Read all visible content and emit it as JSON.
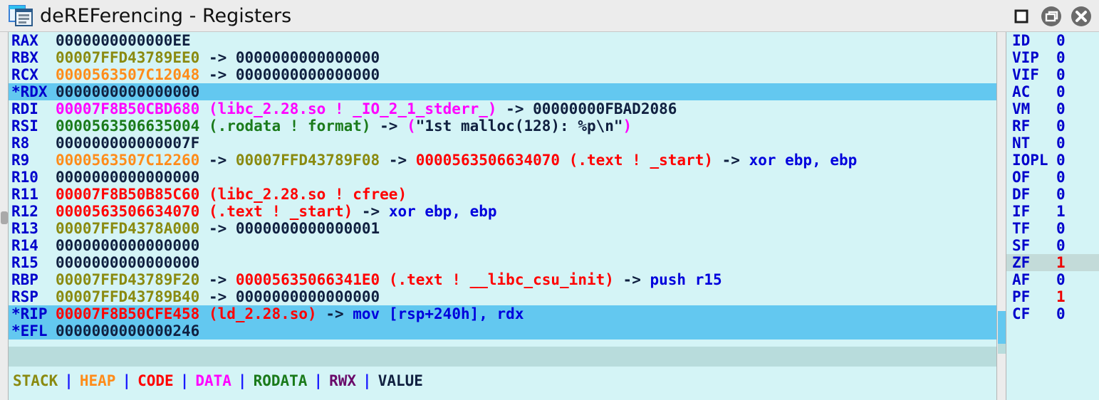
{
  "window": {
    "title": "deREFerencing - Registers",
    "icon": "document-windows-icon",
    "controls": [
      {
        "name": "maximize-button",
        "glyph": "square"
      },
      {
        "name": "restore-button",
        "glyph": "windows"
      },
      {
        "name": "close-button",
        "glyph": "x"
      }
    ]
  },
  "colors": {
    "stack": "#8a8a10",
    "heap": "#ff8c1a",
    "code": "#ff0000",
    "data": "#ff00ff",
    "rodata": "#1a7a1a",
    "rwx": "#6a0a6a",
    "value": "#102040",
    "register_name": "#0000cc",
    "highlight_row": "#63c8f0",
    "pane_background": "#d4f4f6",
    "flag_highlight": "#c3dbd9",
    "flag_set": "#ee0000"
  },
  "registers": [
    {
      "name": "RAX",
      "marked": false,
      "highlight": false,
      "segments": [
        {
          "text": "0000000000000EE",
          "class": "c-value"
        }
      ]
    },
    {
      "name": "RBX",
      "marked": false,
      "highlight": false,
      "segments": [
        {
          "text": "00007FFD43789EE0",
          "class": "c-stack"
        },
        {
          "text": " -> ",
          "class": "c-arrow"
        },
        {
          "text": "0000000000000000",
          "class": "c-value"
        }
      ]
    },
    {
      "name": "RCX",
      "marked": false,
      "highlight": false,
      "segments": [
        {
          "text": "0000563507C12048",
          "class": "c-heap"
        },
        {
          "text": " -> ",
          "class": "c-arrow"
        },
        {
          "text": "0000000000000000",
          "class": "c-value"
        }
      ]
    },
    {
      "name": "RDX",
      "marked": true,
      "highlight": true,
      "segments": [
        {
          "text": "0000000000000000",
          "class": "c-value"
        }
      ]
    },
    {
      "name": "RDI",
      "marked": false,
      "highlight": false,
      "segments": [
        {
          "text": "00007F8B50CBD680",
          "class": "c-data"
        },
        {
          "text": " (libc_2.28.so ! _IO_2_1_stderr_)",
          "class": "c-data"
        },
        {
          "text": " -> ",
          "class": "c-arrow"
        },
        {
          "text": "00000000FBAD2086",
          "class": "c-value"
        }
      ]
    },
    {
      "name": "RSI",
      "marked": false,
      "highlight": false,
      "segments": [
        {
          "text": "0000563506635004",
          "class": "c-rodata"
        },
        {
          "text": " (.rodata ! format)",
          "class": "c-rodata"
        },
        {
          "text": " -> ",
          "class": "c-arrow"
        },
        {
          "text": "(",
          "class": "c-data"
        },
        {
          "text": "\"1st malloc(128): %p\\n\"",
          "class": "c-str"
        },
        {
          "text": ")",
          "class": "c-data"
        }
      ]
    },
    {
      "name": "R8",
      "marked": false,
      "highlight": false,
      "segments": [
        {
          "text": "000000000000007F",
          "class": "c-value"
        }
      ]
    },
    {
      "name": "R9",
      "marked": false,
      "highlight": false,
      "segments": [
        {
          "text": "0000563507C12260",
          "class": "c-heap"
        },
        {
          "text": " -> ",
          "class": "c-arrow"
        },
        {
          "text": "00007FFD43789F08",
          "class": "c-stack"
        },
        {
          "text": " -> ",
          "class": "c-arrow"
        },
        {
          "text": "0000563506634070",
          "class": "c-code"
        },
        {
          "text": " (.text ! _start)",
          "class": "c-code"
        },
        {
          "text": " -> ",
          "class": "c-arrow"
        },
        {
          "text": "xor ebp, ebp",
          "class": "c-asm"
        }
      ]
    },
    {
      "name": "R10",
      "marked": false,
      "highlight": false,
      "segments": [
        {
          "text": "0000000000000000",
          "class": "c-value"
        }
      ]
    },
    {
      "name": "R11",
      "marked": false,
      "highlight": false,
      "segments": [
        {
          "text": "00007F8B50B85C60",
          "class": "c-code"
        },
        {
          "text": " (libc_2.28.so ! cfree)",
          "class": "c-code"
        }
      ]
    },
    {
      "name": "R12",
      "marked": false,
      "highlight": false,
      "segments": [
        {
          "text": "0000563506634070",
          "class": "c-code"
        },
        {
          "text": " (.text ! _start)",
          "class": "c-code"
        },
        {
          "text": " -> ",
          "class": "c-arrow"
        },
        {
          "text": "xor ebp, ebp",
          "class": "c-asm"
        }
      ]
    },
    {
      "name": "R13",
      "marked": false,
      "highlight": false,
      "segments": [
        {
          "text": "00007FFD4378A000",
          "class": "c-stack"
        },
        {
          "text": " -> ",
          "class": "c-arrow"
        },
        {
          "text": "0000000000000001",
          "class": "c-value"
        }
      ]
    },
    {
      "name": "R14",
      "marked": false,
      "highlight": false,
      "segments": [
        {
          "text": "0000000000000000",
          "class": "c-value"
        }
      ]
    },
    {
      "name": "R15",
      "marked": false,
      "highlight": false,
      "segments": [
        {
          "text": "0000000000000000",
          "class": "c-value"
        }
      ]
    },
    {
      "name": "RBP",
      "marked": false,
      "highlight": false,
      "segments": [
        {
          "text": "00007FFD43789F20",
          "class": "c-stack"
        },
        {
          "text": " -> ",
          "class": "c-arrow"
        },
        {
          "text": "00005635066341E0",
          "class": "c-code"
        },
        {
          "text": " (.text ! __libc_csu_init)",
          "class": "c-code"
        },
        {
          "text": " -> ",
          "class": "c-arrow"
        },
        {
          "text": "push r15",
          "class": "c-asm"
        }
      ]
    },
    {
      "name": "RSP",
      "marked": false,
      "highlight": false,
      "segments": [
        {
          "text": "00007FFD43789B40",
          "class": "c-stack"
        },
        {
          "text": " -> ",
          "class": "c-arrow"
        },
        {
          "text": "0000000000000000",
          "class": "c-value"
        }
      ]
    },
    {
      "name": "RIP",
      "marked": true,
      "highlight": true,
      "segments": [
        {
          "text": "00007F8B50CFE458",
          "class": "c-code"
        },
        {
          "text": " (ld_2.28.so)",
          "class": "c-code"
        },
        {
          "text": " -> ",
          "class": "c-arrow"
        },
        {
          "text": "mov [rsp+240h], rdx",
          "class": "c-asm"
        }
      ]
    },
    {
      "name": "EFL",
      "marked": true,
      "highlight": true,
      "segments": [
        {
          "text": "0000000000000246",
          "class": "c-value"
        }
      ]
    }
  ],
  "flags": [
    {
      "name": "ID",
      "value": "0",
      "set": false,
      "highlight": false
    },
    {
      "name": "VIP",
      "value": "0",
      "set": false,
      "highlight": false
    },
    {
      "name": "VIF",
      "value": "0",
      "set": false,
      "highlight": false
    },
    {
      "name": "AC",
      "value": "0",
      "set": false,
      "highlight": false
    },
    {
      "name": "VM",
      "value": "0",
      "set": false,
      "highlight": false
    },
    {
      "name": "RF",
      "value": "0",
      "set": false,
      "highlight": false
    },
    {
      "name": "NT",
      "value": "0",
      "set": false,
      "highlight": false
    },
    {
      "name": "IOPL",
      "value": "0",
      "set": false,
      "highlight": false
    },
    {
      "name": "OF",
      "value": "0",
      "set": false,
      "highlight": false
    },
    {
      "name": "DF",
      "value": "0",
      "set": false,
      "highlight": false
    },
    {
      "name": "IF",
      "value": "1",
      "set": false,
      "highlight": false
    },
    {
      "name": "TF",
      "value": "0",
      "set": false,
      "highlight": false
    },
    {
      "name": "SF",
      "value": "0",
      "set": false,
      "highlight": false
    },
    {
      "name": "ZF",
      "value": "1",
      "set": true,
      "highlight": true
    },
    {
      "name": "AF",
      "value": "0",
      "set": false,
      "highlight": false
    },
    {
      "name": "PF",
      "value": "1",
      "set": true,
      "highlight": false
    },
    {
      "name": "CF",
      "value": "0",
      "set": false,
      "highlight": false
    }
  ],
  "legend": {
    "separator": "|",
    "items": [
      {
        "label": "STACK",
        "class": "c-stack"
      },
      {
        "label": "HEAP",
        "class": "c-heap"
      },
      {
        "label": "CODE",
        "class": "c-code"
      },
      {
        "label": "DATA",
        "class": "c-data"
      },
      {
        "label": "RODATA",
        "class": "c-rodata"
      },
      {
        "label": "RWX",
        "class": "c-rwx"
      },
      {
        "label": "VALUE",
        "class": "c-value"
      }
    ]
  }
}
